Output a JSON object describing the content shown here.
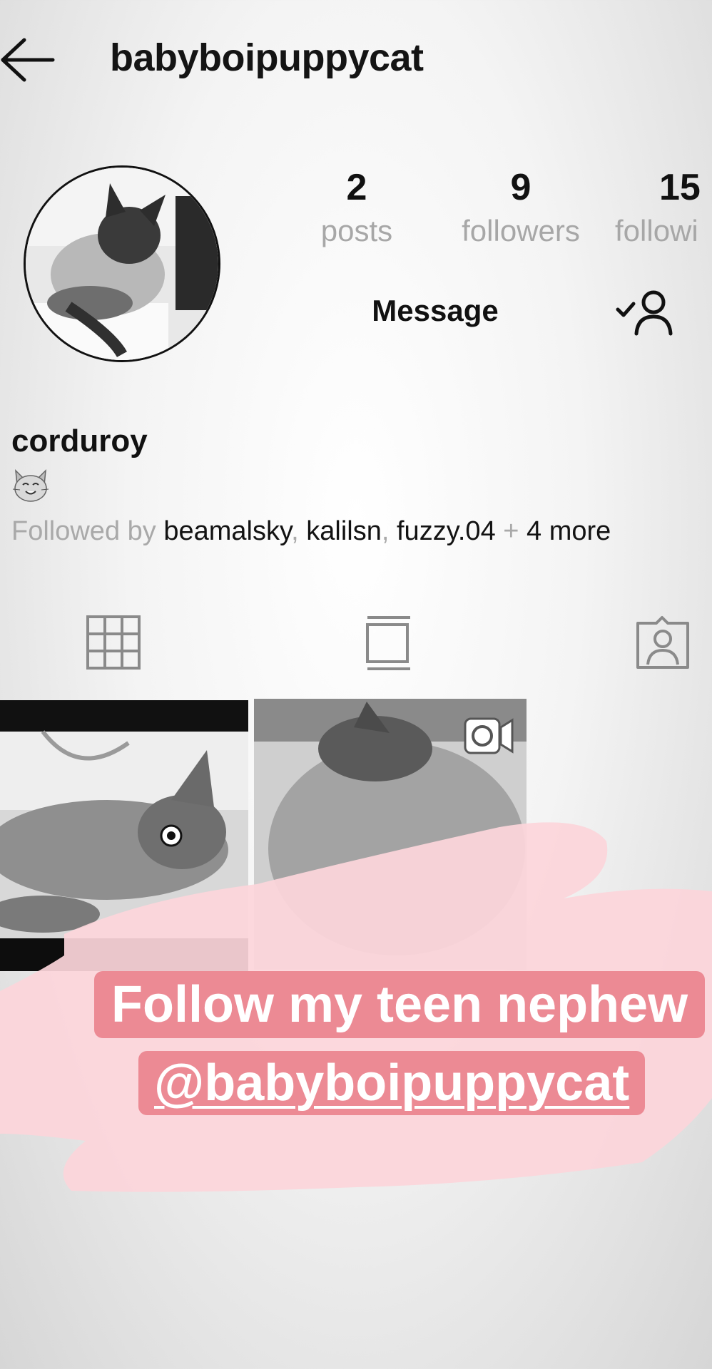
{
  "header": {
    "username": "babyboipuppycat",
    "back_icon": "arrow-left-icon"
  },
  "profile": {
    "avatar_icon": "cat-photo",
    "stats": {
      "posts": {
        "value": "2",
        "label": "posts"
      },
      "followers": {
        "value": "9",
        "label": "followers"
      },
      "following": {
        "value": "15",
        "label": "followi"
      }
    },
    "message_label": "Message",
    "follow_status_icon": "following-check-user-icon",
    "display_name": "corduroy",
    "bio_emoji": "cat-face-icon",
    "followed_by": {
      "prefix": "Followed by ",
      "users": [
        "beamalsky",
        "kalilsn",
        "fuzzy.04"
      ],
      "separator": ", ",
      "plus": " + ",
      "more": "4 more"
    }
  },
  "tabs": [
    {
      "icon": "grid-icon"
    },
    {
      "icon": "feed-icon"
    },
    {
      "icon": "tagged-user-icon"
    }
  ],
  "posts": [
    {
      "type": "photo"
    },
    {
      "type": "video",
      "badge_icon": "video-camera-icon"
    }
  ],
  "sticker": {
    "line1": "Follow my teen nephew",
    "line2": "@babyboipuppycat",
    "text_color": "#ffffff",
    "label_color": "#ec8a94",
    "blob_color": "#fcd5da"
  }
}
